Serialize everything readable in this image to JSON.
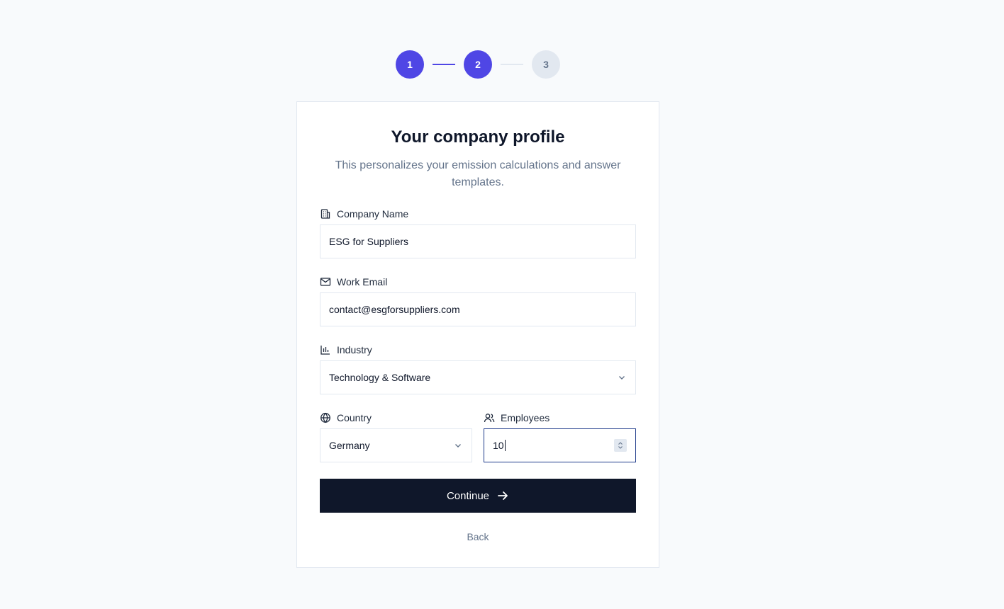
{
  "stepper": {
    "steps": [
      {
        "label": "1",
        "state": "done"
      },
      {
        "label": "2",
        "state": "active"
      },
      {
        "label": "3",
        "state": "todo"
      }
    ],
    "accent_color": "#4f46e5"
  },
  "card": {
    "title": "Your company profile",
    "subtitle": "This personalizes your emission calculations and answer templates."
  },
  "fields": {
    "company_name": {
      "label": "Company Name",
      "icon": "building-icon",
      "value": "ESG for Suppliers"
    },
    "work_email": {
      "label": "Work Email",
      "icon": "mail-icon",
      "value": "contact@esgforsuppliers.com"
    },
    "industry": {
      "label": "Industry",
      "icon": "bar-chart-icon",
      "value": "Technology & Software"
    },
    "country": {
      "label": "Country",
      "icon": "globe-icon",
      "value": "Germany"
    },
    "employees": {
      "label": "Employees",
      "icon": "users-icon",
      "value": "10"
    }
  },
  "actions": {
    "continue_label": "Continue",
    "back_label": "Back"
  }
}
